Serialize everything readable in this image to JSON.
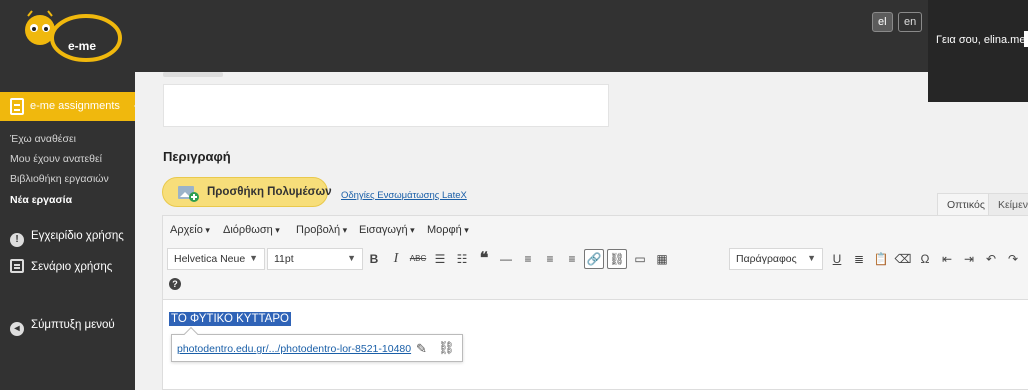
{
  "header": {
    "brand": "e-me",
    "languages": [
      {
        "code": "el",
        "active": true
      },
      {
        "code": "en",
        "active": false
      }
    ],
    "greeting": "Γεια σου, elina.mega"
  },
  "sidebar": {
    "active_label": "e-me assignments",
    "sub_items": [
      {
        "label": "Έχω αναθέσει",
        "bold": false
      },
      {
        "label": "Μου έχουν ανατεθεί",
        "bold": false
      },
      {
        "label": "Βιβλιοθήκη εργασιών",
        "bold": false
      },
      {
        "label": "Νέα εργασία",
        "bold": true
      }
    ],
    "links": {
      "manual": "Εγχειρίδιο χρήσης",
      "scenario": "Σενάριο χρήσης",
      "collapse": "Σύμπτυξη μενού"
    }
  },
  "main": {
    "description_label": "Περιγραφή",
    "add_media_label": "Προσθήκη Πολυμέσων",
    "latex_link": "Οδηγίες Ενσωμάτωσης LateX",
    "mode_tabs": {
      "visual": "Οπτικός",
      "text": "Κείμενο"
    }
  },
  "editor": {
    "menus": [
      "Αρχείο",
      "Διόρθωση",
      "Προβολή",
      "Εισαγωγή",
      "Μορφή"
    ],
    "font_family": "Helvetica Neue",
    "font_size": "11pt",
    "paragraph": "Παράγραφος",
    "content_text": "ΤΟ ΦΥΤΙΚΟ ΚΥΤΤΑΡΟ",
    "link_url": "photodentro.edu.gr/.../photodentro-lor-8521-10480",
    "help_icon": "?"
  },
  "colors": {
    "accent": "#f0b80d",
    "topbar": "#323232",
    "selection": "#2f63b7",
    "link": "#1a5fa8"
  }
}
